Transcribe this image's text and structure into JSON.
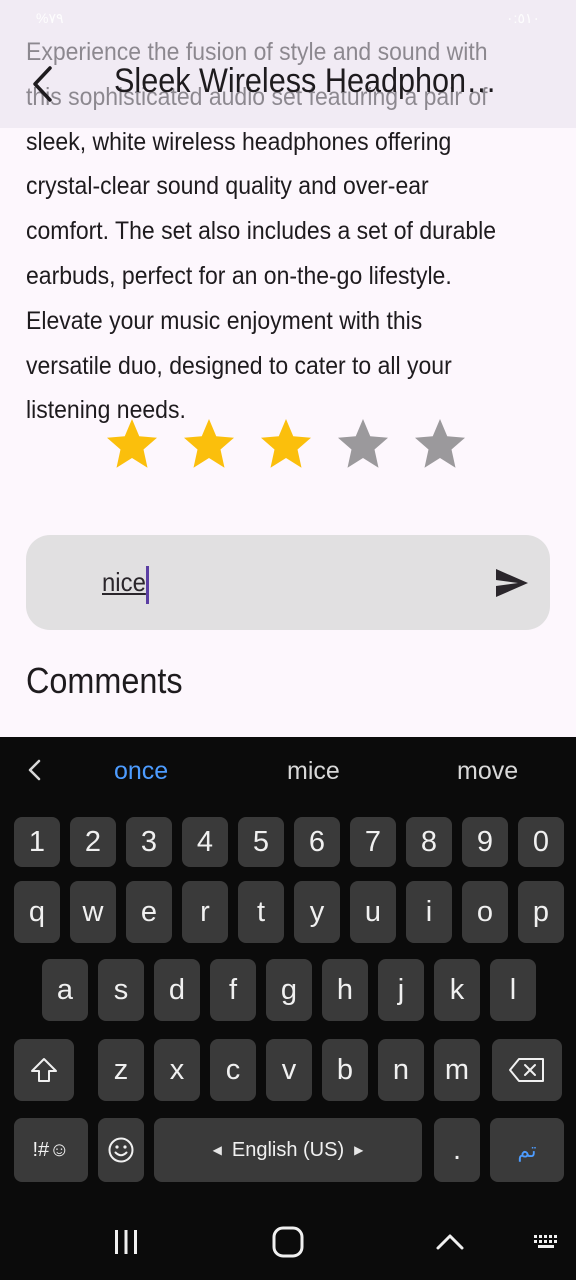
{
  "status_bar": {
    "left_text": "%٧٩",
    "right_text": "٠:٥١٠"
  },
  "header": {
    "title": "Sleek Wireless Headphone & Earbuds Set"
  },
  "product": {
    "description": "Experience the fusion of style and sound with this sophisticated audio set featuring a pair of sleek, white wireless headphones offering crystal-clear sound quality and over-ear comfort. The set also includes a set of durable earbuds, perfect for an on-the-go lifestyle. Elevate your music enjoyment with this versatile duo, designed to cater to all your listening needs.",
    "rating": 3,
    "rating_max": 5
  },
  "comment": {
    "value": "nice"
  },
  "comments_heading": "Comments",
  "keyboard": {
    "suggestions": [
      "once",
      "mice",
      "move"
    ],
    "row_numbers": [
      "1",
      "2",
      "3",
      "4",
      "5",
      "6",
      "7",
      "8",
      "9",
      "0"
    ],
    "row_1": [
      "q",
      "w",
      "e",
      "r",
      "t",
      "y",
      "u",
      "i",
      "o",
      "p"
    ],
    "row_2": [
      "a",
      "s",
      "d",
      "f",
      "g",
      "h",
      "j",
      "k",
      "l"
    ],
    "row_3": [
      "z",
      "x",
      "c",
      "v",
      "b",
      "n",
      "m"
    ],
    "symbols_key": "!#☺",
    "space_label": "English (US)",
    "period_key": ".",
    "done_key": "تم"
  },
  "colors": {
    "star_filled": "#fbbf0c",
    "star_empty": "#9b999c",
    "accent": "#4d9cff"
  }
}
